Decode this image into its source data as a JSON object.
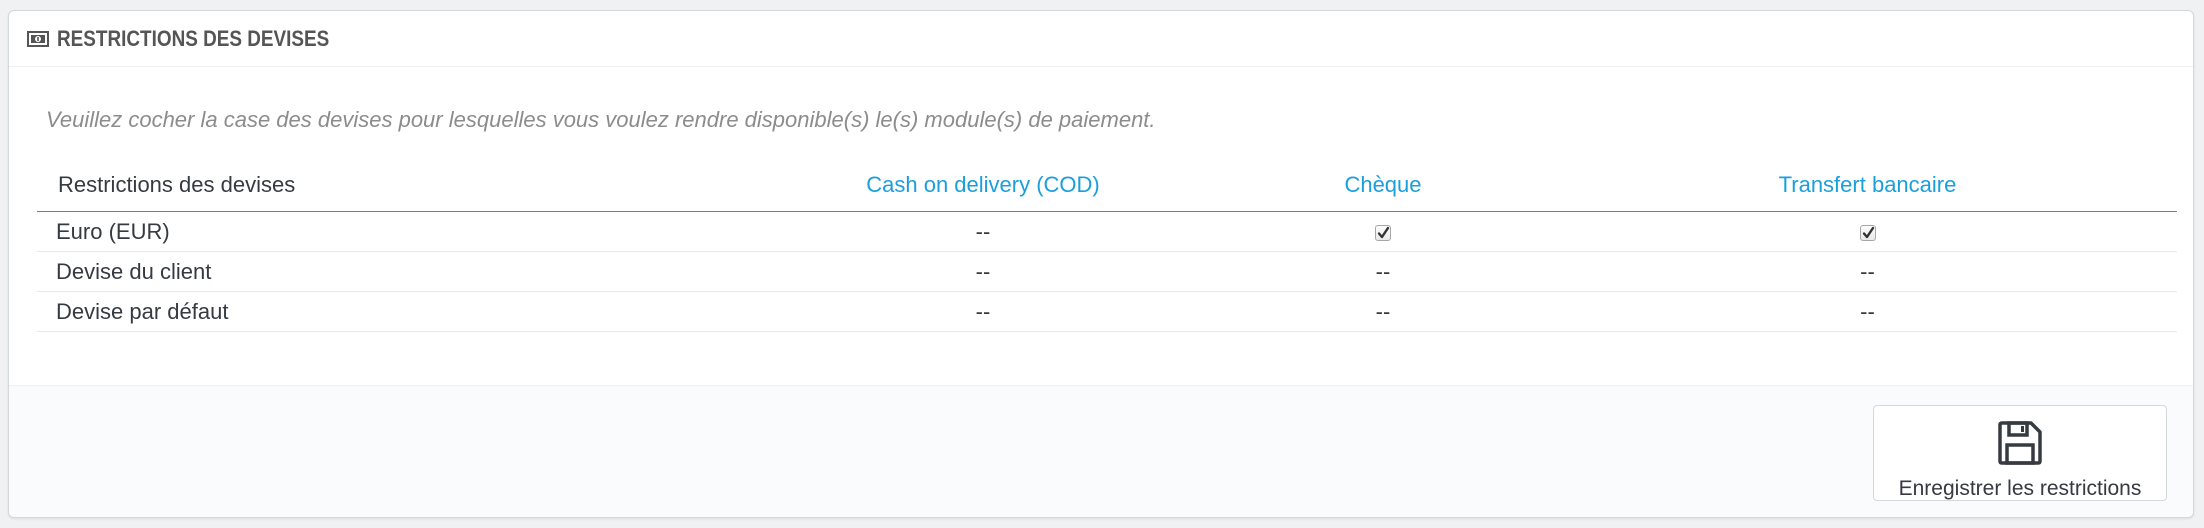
{
  "panel": {
    "title": "RESTRICTIONS DES DEVISES",
    "title_icon": "money-icon",
    "help_text": "Veuillez cocher la case des devises pour lesquelles vous voulez rendre disponible(s) le(s) module(s) de paiement."
  },
  "table": {
    "headers": [
      "Restrictions des devises",
      "Cash on delivery (COD)",
      "Chèque",
      "Transfert bancaire"
    ],
    "rows": [
      {
        "label": "Euro (EUR)",
        "cells": [
          "--",
          "checked",
          "checked"
        ]
      },
      {
        "label": "Devise du client",
        "cells": [
          "--",
          "--",
          "--"
        ]
      },
      {
        "label": "Devise par défaut",
        "cells": [
          "--",
          "--",
          "--"
        ]
      }
    ]
  },
  "footer": {
    "save_label": "Enregistrer les restrictions",
    "save_icon": "save-icon"
  },
  "colors": {
    "accent": "#1b9fdc",
    "text": "#363a41",
    "muted": "#8c8c8c"
  }
}
